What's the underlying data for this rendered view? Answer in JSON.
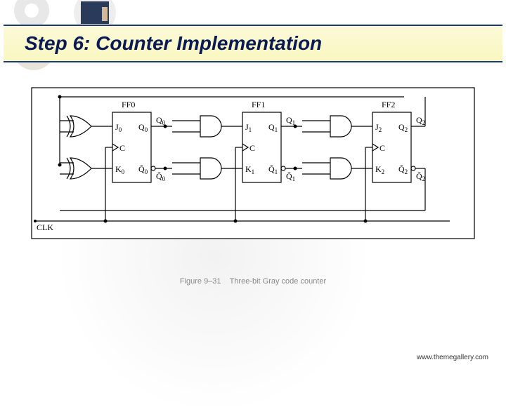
{
  "header": {
    "title": "Step 6: Counter Implementation"
  },
  "ff": [
    {
      "label": "FF0",
      "J": "J",
      "K": "K",
      "C": "C",
      "Q": "Q",
      "Qb": "Q̄",
      "sub": "0"
    },
    {
      "label": "FF1",
      "J": "J",
      "K": "K",
      "C": "C",
      "Q": "Q",
      "Qb": "Q̄",
      "sub": "1"
    },
    {
      "label": "FF2",
      "J": "J",
      "K": "K",
      "C": "C",
      "Q": "Q",
      "Qb": "Q̄",
      "sub": "2"
    }
  ],
  "clk_label": "CLK",
  "caption": {
    "fig_no": "Figure 9–31",
    "desc": "Three-bit Gray code counter"
  },
  "footer": {
    "url": "www.themegallery.com"
  }
}
